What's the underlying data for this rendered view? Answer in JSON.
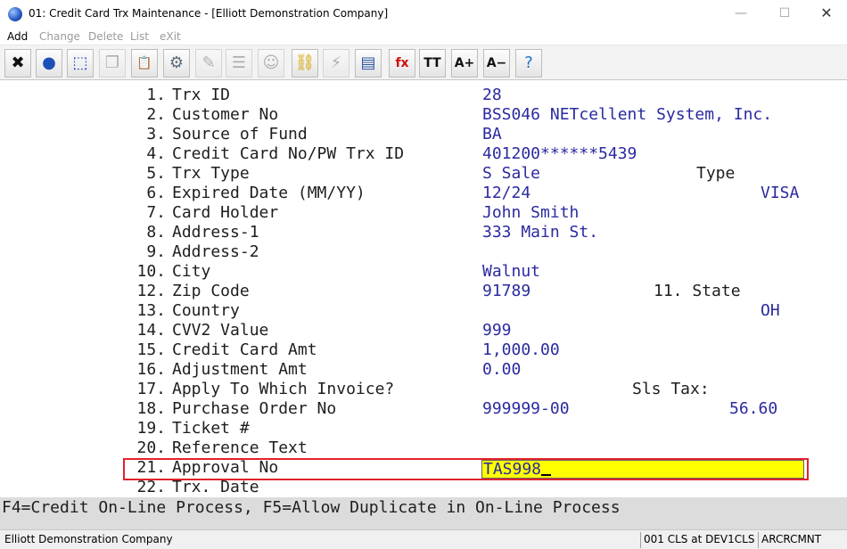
{
  "window": {
    "title": "01: Credit Card Trx Maintenance - [Elliott Demonstration Company]",
    "minimize": "—",
    "maximize": "☐",
    "close": "✕"
  },
  "menu": [
    {
      "label": "Add",
      "active": true
    },
    {
      "label": "Change",
      "active": false
    },
    {
      "label": "Delete",
      "active": false
    },
    {
      "label": "List",
      "active": false
    },
    {
      "label": "eXit",
      "active": false
    }
  ],
  "toolbar": [
    {
      "icon": "close-x-icon",
      "glyph": "✖",
      "color": "#111111",
      "enabled": true
    },
    {
      "icon": "globe-icon",
      "glyph": "●",
      "color": "#1d4fb8",
      "enabled": true
    },
    {
      "icon": "select-box-icon",
      "glyph": "⬚",
      "color": "#1d3fb8",
      "enabled": true
    },
    {
      "icon": "copy-icon",
      "glyph": "❐",
      "color": "#777777",
      "enabled": false
    },
    {
      "icon": "paste-icon",
      "glyph": "📋",
      "color": "#b58b2a",
      "enabled": true
    },
    {
      "icon": "gear-icon",
      "glyph": "⚙",
      "color": "#5a6a7a",
      "enabled": true
    },
    {
      "icon": "edit-form-icon",
      "glyph": "✎",
      "color": "#777777",
      "enabled": false
    },
    {
      "icon": "list-icon",
      "glyph": "☰",
      "color": "#777777",
      "enabled": false
    },
    {
      "icon": "users-icon",
      "glyph": "☺",
      "color": "#777777",
      "enabled": false
    },
    {
      "icon": "link-chain-icon",
      "glyph": "⛓",
      "color": "#d4a400",
      "enabled": true
    },
    {
      "icon": "lightning-icon",
      "glyph": "⚡",
      "color": "#777777",
      "enabled": false
    },
    {
      "icon": "calendar-run-icon",
      "glyph": "▤",
      "color": "#2a5aa0",
      "enabled": true
    },
    {
      "icon": "function-fx-icon",
      "glyph": "fx",
      "color": "#d01010",
      "enabled": true
    },
    {
      "icon": "font-size-icon",
      "glyph": "TT",
      "color": "#111111",
      "enabled": true
    },
    {
      "icon": "font-increase-icon",
      "glyph": "A+",
      "color": "#111111",
      "enabled": true
    },
    {
      "icon": "font-decrease-icon",
      "glyph": "A−",
      "color": "#111111",
      "enabled": true
    },
    {
      "icon": "help-icon",
      "glyph": "?",
      "color": "#1f6fd0",
      "enabled": true
    }
  ],
  "fields": [
    {
      "num": "1.",
      "label": "Trx ID",
      "value": "28"
    },
    {
      "num": "2.",
      "label": "Customer No",
      "value": "BSS046 NETcellent System, Inc."
    },
    {
      "num": "3.",
      "label": "Source of Fund",
      "value": "BA"
    },
    {
      "num": "4.",
      "label": "Credit Card No/PW Trx ID",
      "value": "401200******5439"
    },
    {
      "num": "5.",
      "label": "Trx Type",
      "value": "S Sale"
    },
    {
      "num": "6.",
      "label": "Expired Date (MM/YY)",
      "value": "12/24"
    },
    {
      "num": "7.",
      "label": "Card Holder",
      "value": "John Smith"
    },
    {
      "num": "8.",
      "label": "Address-1",
      "value": "333 Main St."
    },
    {
      "num": "9.",
      "label": "Address-2",
      "value": ""
    },
    {
      "num": "10.",
      "label": "City",
      "value": "Walnut"
    },
    {
      "num": "12.",
      "label": "Zip Code",
      "value": "91789"
    },
    {
      "num": "13.",
      "label": "Country",
      "value": ""
    },
    {
      "num": "14.",
      "label": "CVV2 Value",
      "value": "999"
    },
    {
      "num": "15.",
      "label": "Credit Card Amt",
      "value": "1,000.00"
    },
    {
      "num": "16.",
      "label": "Adjustment Amt",
      "value": "0.00"
    },
    {
      "num": "17.",
      "label": "Apply To Which Invoice?",
      "value": ""
    },
    {
      "num": "18.",
      "label": "Purchase Order No",
      "value": "999999-00"
    },
    {
      "num": "19.",
      "label": "Ticket #",
      "value": ""
    },
    {
      "num": "20.",
      "label": "Reference Text",
      "value": ""
    },
    {
      "num": "21.",
      "label": "Approval No",
      "value": "TAS998"
    },
    {
      "num": "22.",
      "label": "Trx. Date",
      "value": ""
    }
  ],
  "extras": {
    "type_label": "Type",
    "type_value": "VISA",
    "state_label": "11. State",
    "state_value": "OH",
    "sls_tax_label": "Sls Tax:",
    "sls_tax_value": "56.60"
  },
  "fkey_line": "F4=Credit On-Line Process, F5=Allow Duplicate in On-Line Process",
  "status": {
    "company": "Elliott Demonstration Company",
    "session": "001 CLS at DEV1CLS",
    "program": "ARCRCMNT"
  },
  "colors": {
    "field_value": "#2a2aa0",
    "input_background": "#ffff00",
    "focus_border": "#e2232a"
  }
}
